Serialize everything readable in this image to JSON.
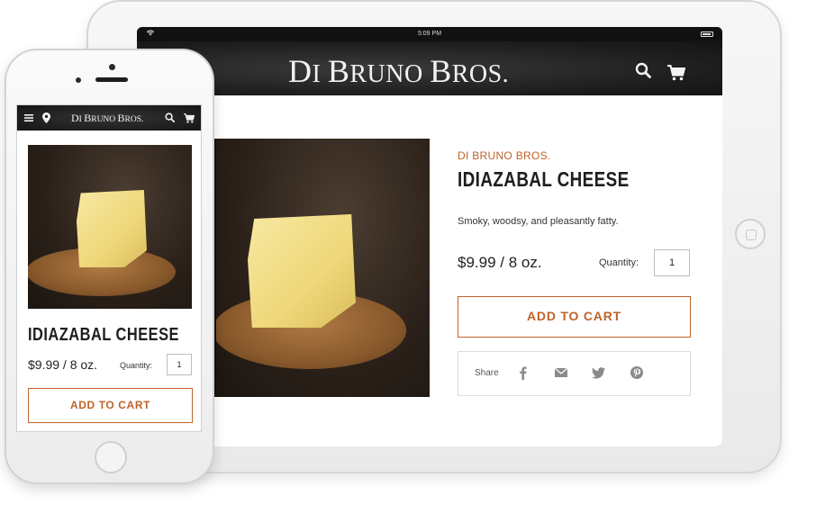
{
  "colors": {
    "accent": "#c0622a",
    "header_bg": "#1d1d1d",
    "title_text": "#1e1e1e"
  },
  "tablet": {
    "status_time": "5:09 PM",
    "logo_main": "Di Bruno Bros.",
    "logo_big_D": "D",
    "logo_small_i": "I ",
    "logo_big_B1": "B",
    "logo_small_runo": "RUNO ",
    "logo_big_B2": "B",
    "logo_small_ros": "ROS.",
    "brand_label": "DI BRUNO BROS.",
    "product_title": "IDIAZABAL CHEESE",
    "description": "Smoky, woodsy, and pleasantly fatty.",
    "price": "$9.99 / 8 oz.",
    "quantity_label": "Quantity:",
    "quantity_value": "1",
    "add_to_cart": "ADD TO CART",
    "share_label": "Share",
    "share_icons": [
      "facebook-icon",
      "email-icon",
      "twitter-icon",
      "pinterest-icon"
    ]
  },
  "phone": {
    "logo_big_D": "D",
    "logo_small_i": "I ",
    "logo_big_B1": "B",
    "logo_small_runo": "RUNO ",
    "logo_big_B2": "B",
    "logo_small_ros": "ROS.",
    "product_title": "IDIAZABAL CHEESE",
    "price": "$9.99 / 8 oz.",
    "quantity_label": "Quantity:",
    "quantity_value": "1",
    "add_to_cart": "ADD TO CART"
  }
}
